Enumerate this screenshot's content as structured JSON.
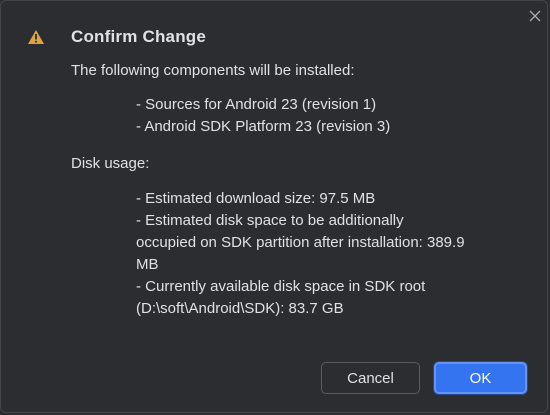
{
  "dialog": {
    "title": "Confirm Change",
    "intro": "The following components will be installed:",
    "components": [
      "- Sources for Android 23 (revision 1)",
      "- Android SDK Platform 23 (revision 3)"
    ],
    "disk_label": "Disk usage:",
    "disk_lines": [
      "- Estimated download size: 97.5 MB",
      "- Estimated disk space to be additionally",
      "occupied on SDK partition after installation: 389.9",
      "MB",
      "- Currently available disk space in SDK root",
      "(D:\\soft\\Android\\SDK): 83.7 GB"
    ]
  },
  "buttons": {
    "cancel_label": "Cancel",
    "ok_label": "OK"
  },
  "icons": {
    "warning": "warning-icon",
    "close": "close-icon"
  },
  "colors": {
    "background": "#2b2d30",
    "text": "#dfe1e5",
    "accent": "#3574f0",
    "warning": "#e0a33b"
  }
}
